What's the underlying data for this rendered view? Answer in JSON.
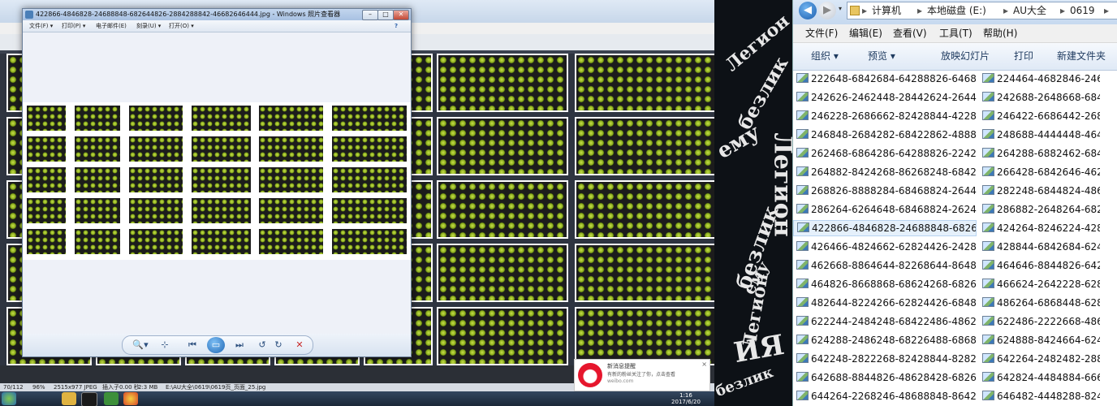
{
  "background_app": {
    "status_items": [
      "70/112",
      "96%",
      "2515x977 JPEG",
      "插入子0.00 秒",
      "2:3 MB",
      "E:\\AU大全\\0619\\0619页_页面_25.jpg"
    ],
    "clock": {
      "time": "1:16",
      "date": "2017/6/20"
    }
  },
  "viewer": {
    "title": "422866-4846828-24688848-682644826-2884288842-46682646444.jpg - Windows 照片查看器",
    "menu": [
      "文件(F) ▾",
      "打印(P) ▾",
      "电子邮件(E)",
      "刻录(U) ▾",
      "打开(O) ▾"
    ],
    "help": "?",
    "window_buttons": [
      "–",
      "□",
      "✕"
    ],
    "controls": [
      "🔍▾",
      "⊹",
      "⏮",
      "▭",
      "⏭",
      "↺",
      "↻",
      "✕"
    ]
  },
  "notification": {
    "title": "新消息提醒",
    "body": "有新的粉丝关注了你，点击查看",
    "url": "weibo.com",
    "close": "×"
  },
  "desktop_words": [
    "Легион",
    "безлик",
    "ему",
    "Легион",
    "безлик",
    "ему",
    "Легион",
    "ИЯ",
    "безлик"
  ],
  "explorer": {
    "nav": {
      "back": "◀",
      "forward": "▶",
      "dropdown": "▾"
    },
    "breadcrumb": [
      "计算机",
      "本地磁盘 (E:)",
      "AU大全",
      "0619"
    ],
    "crumb_sep": "▸",
    "menu": [
      "文件(F)",
      "编辑(E)",
      "查看(V)",
      "工具(T)",
      "帮助(H)"
    ],
    "toolbar": [
      "组织 ▾",
      "预览 ▾",
      "放映幻灯片",
      "打印",
      "新建文件夹"
    ],
    "files_col1": [
      "222648-6842684-64288826-6468...",
      "242626-2462448-28442624-2644...",
      "246228-2686662-82428844-4228...",
      "246848-2684282-68422862-4888...",
      "262468-6864286-64288826-2242...",
      "264882-8424268-86268248-6842...",
      "268826-8888284-68468824-2644...",
      "286264-6264648-68468824-2624...",
      "422866-4846828-24688848-6826...",
      "426466-4824662-62824426-2428...",
      "462668-8864644-82268644-8648...",
      "464826-8668868-68624268-6826...",
      "482644-8224266-62824426-6848...",
      "622244-2484248-68422486-4862...",
      "624288-2486248-68226488-6868...",
      "642248-2822268-82428844-8282...",
      "642688-8844826-48628428-6826...",
      "644264-2268246-48688848-8642..."
    ],
    "files_col2": [
      "224464-4682846-2462",
      "242688-2648668-6842",
      "246422-6686442-2684",
      "248688-4444448-4642",
      "264288-6882462-6842",
      "266428-6842646-4628",
      "282248-6844824-4868",
      "286882-2648264-6822",
      "424264-8246224-4284",
      "428844-6842684-6244",
      "464646-8844826-6428",
      "466624-2642228-6282",
      "486264-6868448-6282",
      "622486-2222668-4868",
      "624888-8424664-6248",
      "642264-2482482-2888",
      "642824-4484884-6668",
      "646482-4448288-8242"
    ],
    "selected_index": 8
  }
}
